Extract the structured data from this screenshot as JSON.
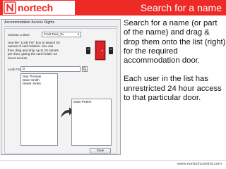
{
  "header": {
    "logo_text": "nortech",
    "title": "Search for a name",
    "accent_color": "#ee2a27"
  },
  "dialog": {
    "title": "Accommodation Access Rights",
    "choose_door_label": "Choose a door:",
    "door_value": "Front Door_IN",
    "instructions": "Use the \"Look For\" box to search for names of card holders. You can then drag and drop up to 10 names per door, giving the card holder 24 hours access.",
    "look_for_label": "Look For:",
    "look_for_value": "D",
    "search_icon": "magnifier-icon",
    "available_names": [
      "Dan Thomas",
      "Dave Smith",
      "Derek Jones"
    ],
    "assigned_names": [
      "Dave Peters"
    ],
    "save_label": "Save"
  },
  "description": {
    "paragraph1": "Search for a name (or part of the name) and drag & drop them onto the list (right) for the required accommodation door.",
    "paragraph2": "Each user in the list has unrestricted 24 hour access to that particular door."
  },
  "footer": {
    "url": "www.nortechcontrol.com"
  }
}
